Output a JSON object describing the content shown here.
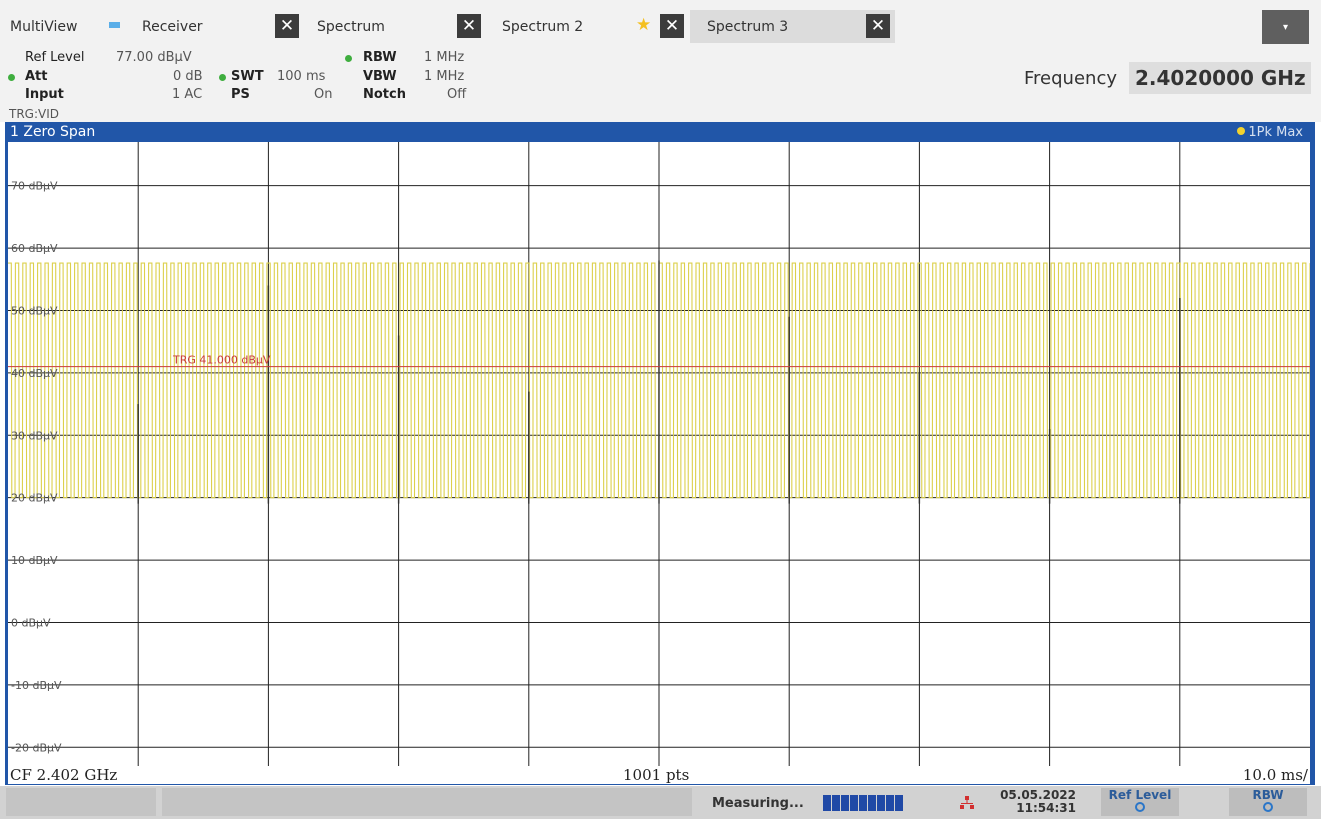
{
  "tabs": {
    "multiview": "MultiView",
    "receiver": "Receiver",
    "spectrum": "Spectrum",
    "spectrum2": "Spectrum 2",
    "spectrum3": "Spectrum 3",
    "close_glyph": "✕",
    "menu_glyph": "▾"
  },
  "settings": {
    "ref_level_key": "Ref Level",
    "ref_level_value": "77.00 dBµV",
    "att_key": "Att",
    "att_value": "0 dB",
    "input_key": "Input",
    "input_value": "1 AC",
    "swt_key": "SWT",
    "swt_value": "100 ms",
    "ps_key": "PS",
    "ps_value": "On",
    "rbw_key": "RBW",
    "rbw_value": "1 MHz",
    "vbw_key": "VBW",
    "vbw_value": "1 MHz",
    "notch_key": "Notch",
    "notch_value": "Off",
    "frequency_label": "Frequency",
    "frequency_value": "2.4020000 GHz",
    "trigger": "TRG:VID"
  },
  "window": {
    "title": "1 Zero Span",
    "trace": "1Pk Max"
  },
  "footer": {
    "cf": "CF 2.402 GHz",
    "pts": "1001 pts",
    "div": "10.0 ms/"
  },
  "status": {
    "text": "Measuring...",
    "date": "05.05.2022",
    "time": "11:54:31",
    "ref_level_btn": "Ref Level",
    "rbw_btn": "RBW"
  },
  "colors": {
    "window_blue": "#2156a8",
    "trace_yellow": "#dcd04c",
    "trigger_red": "#c83a3a",
    "grid": "#222222"
  },
  "chart_data": {
    "type": "line",
    "y_unit": "dBµV",
    "y_ticks": [
      "70 dBµV",
      "60 dBµV",
      "50 dBµV",
      "40 dBµV",
      "30 dBµV",
      "20 dBµV",
      "10 dBµV",
      "0 dBµV",
      "-10 dBµV",
      "-20 dBµV"
    ],
    "y_tick_values": [
      70,
      60,
      50,
      40,
      30,
      20,
      10,
      0,
      -10,
      -20
    ],
    "ylim": [
      -23,
      77
    ],
    "xlim_ms": [
      0,
      100
    ],
    "x_divisions": 10,
    "grid": true,
    "trigger_level": 41.0,
    "trigger_label": "TRG  41.000 dBµV",
    "trace": {
      "name": "1Pk Max",
      "high": 57.6,
      "low": 20.0,
      "cycles": 176
    },
    "spikes": [
      {
        "t_ms": 10,
        "level": 35
      },
      {
        "t_ms": 20,
        "level": 54
      },
      {
        "t_ms": 30,
        "level": 46
      },
      {
        "t_ms": 40,
        "level": 37
      },
      {
        "t_ms": 50,
        "level": 58
      },
      {
        "t_ms": 60,
        "level": 49
      },
      {
        "t_ms": 70,
        "level": 40
      },
      {
        "t_ms": 80,
        "level": 31
      },
      {
        "t_ms": 90,
        "level": 52
      }
    ]
  }
}
